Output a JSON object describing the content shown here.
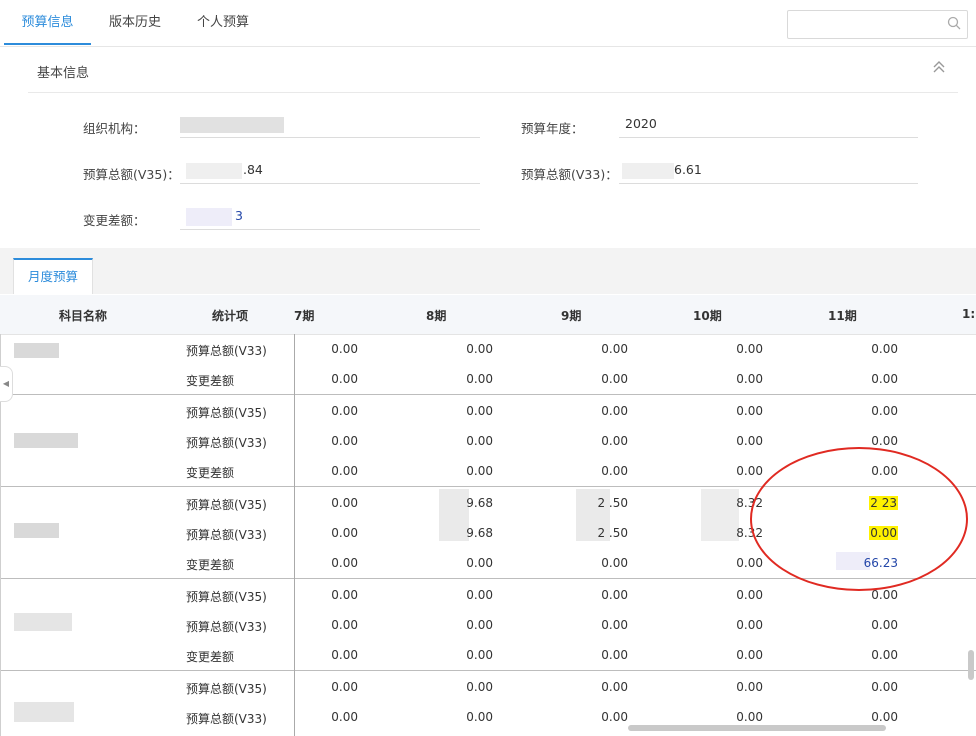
{
  "tabs": [
    "预算信息",
    "版本历史",
    "个人预算"
  ],
  "search": {
    "placeholder": ""
  },
  "basic": {
    "title": "基本信息",
    "org_label": "组织机构：",
    "org_value": "",
    "year_label": "预算年度：",
    "year_value": "2020",
    "total35_label": "预算总额(V35)：",
    "total35_value": ".84",
    "total33_label": "预算总额(V33)：",
    "total33_value": "6.61",
    "diff_label": "变更差额：",
    "diff_value": "3"
  },
  "monthly_tab": "月度预算",
  "table": {
    "headers": {
      "subject": "科目名称",
      "metric": "统计项",
      "p7": "7期",
      "p8": "8期",
      "p9": "9期",
      "p10": "10期",
      "p11": "11期",
      "p12": "1:"
    },
    "rows": [
      {
        "metric": "预算总额(V33)",
        "v": [
          "0.00",
          "0.00",
          "0.00",
          "0.00",
          "0.00"
        ]
      },
      {
        "metric": "变更差额",
        "v": [
          "0.00",
          "0.00",
          "0.00",
          "0.00",
          "0.00"
        ]
      },
      {
        "metric": "预算总额(V35)",
        "v": [
          "0.00",
          "0.00",
          "0.00",
          "0.00",
          "0.00"
        ]
      },
      {
        "metric": "预算总额(V33)",
        "v": [
          "0.00",
          "0.00",
          "0.00",
          "0.00",
          "0.00"
        ]
      },
      {
        "metric": "变更差额",
        "v": [
          "0.00",
          "0.00",
          "0.00",
          "0.00",
          "0.00"
        ]
      },
      {
        "metric": "预算总额(V35)",
        "v": [
          "0.00",
          "9.68",
          "2 .50",
          "8.32",
          "2 23"
        ]
      },
      {
        "metric": "预算总额(V33)",
        "v": [
          "0.00",
          "9.68",
          "2 .50",
          "8.32",
          "0.00"
        ]
      },
      {
        "metric": "变更差额",
        "v": [
          "0.00",
          "0.00",
          "0.00",
          "0.00",
          "66.23"
        ]
      },
      {
        "metric": "预算总额(V35)",
        "v": [
          "0.00",
          "0.00",
          "0.00",
          "0.00",
          "0.00"
        ]
      },
      {
        "metric": "预算总额(V33)",
        "v": [
          "0.00",
          "0.00",
          "0.00",
          "0.00",
          "0.00"
        ]
      },
      {
        "metric": "变更差额",
        "v": [
          "0.00",
          "0.00",
          "0.00",
          "0.00",
          "0.00"
        ]
      },
      {
        "metric": "预算总额(V35)",
        "v": [
          "0.00",
          "0.00",
          "0.00",
          "0.00",
          "0.00"
        ]
      },
      {
        "metric": "预算总额(V33)",
        "v": [
          "0.00",
          "0.00",
          "0.00",
          "0.00",
          "0.00"
        ]
      }
    ]
  },
  "colors": {
    "accent": "#2d8cdb",
    "highlight": "#fff200",
    "annotation": "#e02a22",
    "diff_blue": "#2346a8"
  }
}
